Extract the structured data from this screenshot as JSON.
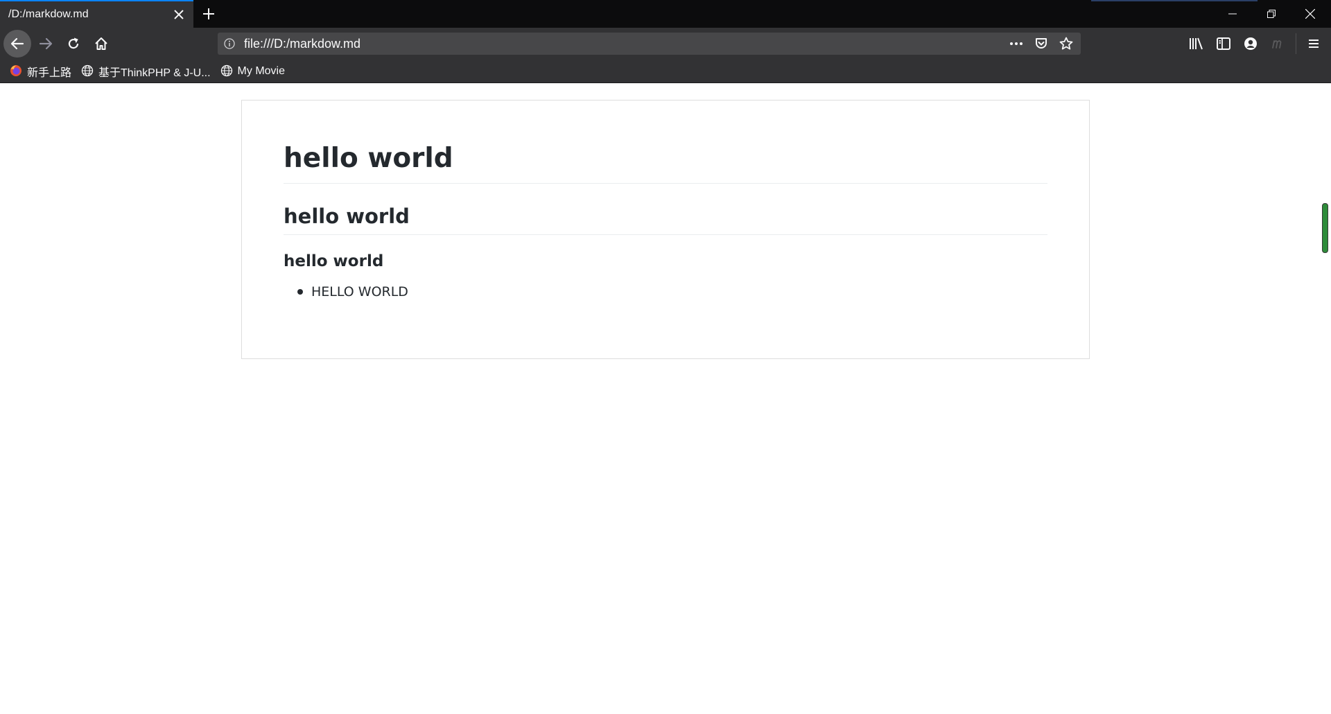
{
  "browser": {
    "tab": {
      "title": "/D:/markdow.md"
    },
    "url": "file:///D:/markdow.md",
    "bookmarks": [
      {
        "label": "新手上路",
        "icon": "firefox-icon"
      },
      {
        "label": "基于ThinkPHP & J-U...",
        "icon": "globe-icon"
      },
      {
        "label": "My Movie",
        "icon": "globe-icon"
      }
    ],
    "colors": {
      "tab_accent": "#0a84ff",
      "toolbar": "#323234",
      "titlebar": "#0c0c0d"
    }
  },
  "document": {
    "h1": "hello world",
    "h2": "hello world",
    "h3": "hello world",
    "list": [
      "HELLO WORLD"
    ]
  }
}
